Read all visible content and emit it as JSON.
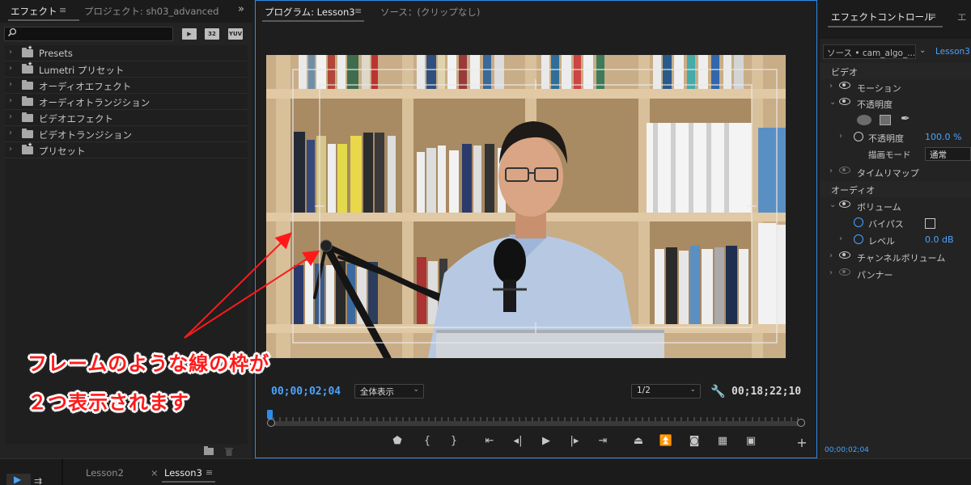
{
  "left_panel": {
    "tabs": [
      {
        "label": "エフェクト",
        "active": true
      },
      {
        "label": "プロジェクト: sh03_advanced",
        "active": false
      }
    ],
    "menu_glyph": "≡",
    "overflow_glyph": "»",
    "search": {
      "placeholder": "",
      "icon": "search-icon"
    },
    "filter_buttons": [
      "▶",
      "32",
      "YUV"
    ],
    "tree": [
      {
        "label": "Presets",
        "icon": "star-folder-icon"
      },
      {
        "label": "Lumetri プリセット",
        "icon": "star-folder-icon"
      },
      {
        "label": "オーディオエフェクト",
        "icon": "folder-icon"
      },
      {
        "label": "オーディオトランジション",
        "icon": "folder-icon"
      },
      {
        "label": "ビデオエフェクト",
        "icon": "folder-icon"
      },
      {
        "label": "ビデオトランジション",
        "icon": "folder-icon"
      },
      {
        "label": "プリセット",
        "icon": "star-folder-icon"
      }
    ]
  },
  "monitor": {
    "tabs": [
      {
        "label": "プログラム: Lesson3",
        "active": true
      },
      {
        "label": "ソース：(クリップなし)",
        "active": false
      }
    ],
    "timecode_current": "00;00;02;04",
    "timecode_duration": "00;18;22;10",
    "zoom_select": "全体表示",
    "resolution_select": "1/2",
    "transport_icons": [
      "marker-icon",
      "mark-in-icon",
      "mark-out-icon",
      "go-to-in-icon",
      "step-back-icon",
      "play-icon",
      "step-forward-icon",
      "go-to-out-icon",
      "lift-icon",
      "extract-icon",
      "export-frame-icon",
      "comparison-view-icon",
      "proxy-toggle-icon",
      "add-button-icon"
    ]
  },
  "effect_controls": {
    "tabs": [
      {
        "label": "エフェクトコントロール",
        "active": true
      },
      {
        "label": "エ",
        "active": false
      }
    ],
    "source": "ソース • cam_algo_...",
    "sequence": "Lesson3 •",
    "video_header": "ビデオ",
    "motion": "モーション",
    "opacity": "不透明度",
    "opacity_param": "不透明度",
    "opacity_value": "100.0 %",
    "blend_label": "描画モード",
    "blend_value": "通常",
    "time_remap": "タイムリマップ",
    "audio_header": "オーディオ",
    "volume": "ボリューム",
    "bypass": "バイパス",
    "level": "レベル",
    "level_value": "0.0 dB",
    "channel_volume": "チャンネルボリューム",
    "panner": "パンナー",
    "footer_timecode": "00;00;02;04"
  },
  "timeline": {
    "tabs": [
      {
        "label": "Lesson2",
        "active": false
      },
      {
        "label": "Lesson3",
        "active": true
      }
    ],
    "close_glyph": "×"
  },
  "annotation": {
    "line1": "フレームのような線の枠が",
    "line2": "２つ表示されます",
    "color": "#ff1a1a"
  }
}
